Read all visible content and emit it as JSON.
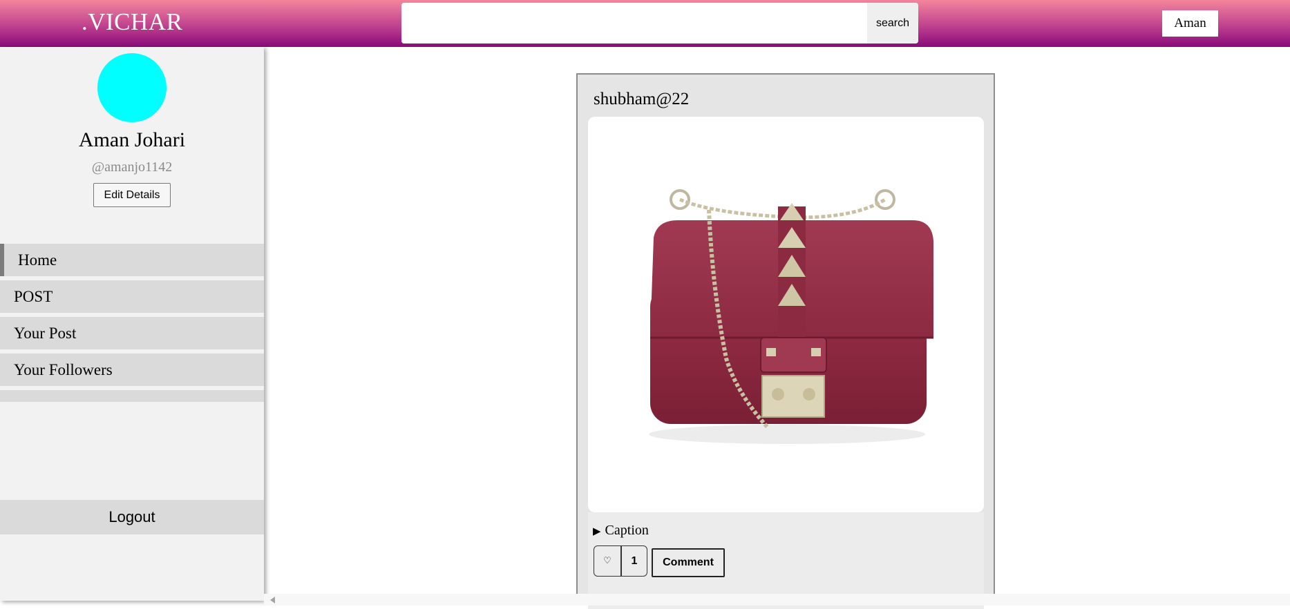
{
  "header": {
    "logo": ".VICHAR",
    "search": {
      "value": "",
      "placeholder": "",
      "button_label": "search"
    },
    "user_button_label": "Aman"
  },
  "sidebar": {
    "profile": {
      "name": "Aman Johari",
      "handle": "@amanjo1142",
      "edit_label": "Edit Details",
      "avatar_color": "#00ffff"
    },
    "nav": [
      {
        "label": "Home",
        "active": true
      },
      {
        "label": "POST",
        "active": false
      },
      {
        "label": "Your Post",
        "active": false
      },
      {
        "label": "Your Followers",
        "active": false
      }
    ],
    "logout_label": "Logout"
  },
  "post": {
    "author": "shubham@22",
    "image_description_icon": "handbag-image",
    "caption_label": "Caption",
    "like_icon": "heart-icon",
    "like_count": "1",
    "comment_label": "Comment"
  },
  "colors": {
    "header_gradient_top": "#f4859b",
    "header_gradient_bottom": "#8a0a7a",
    "sidebar_bg": "#f2f2f2",
    "nav_bg": "#dadada"
  }
}
